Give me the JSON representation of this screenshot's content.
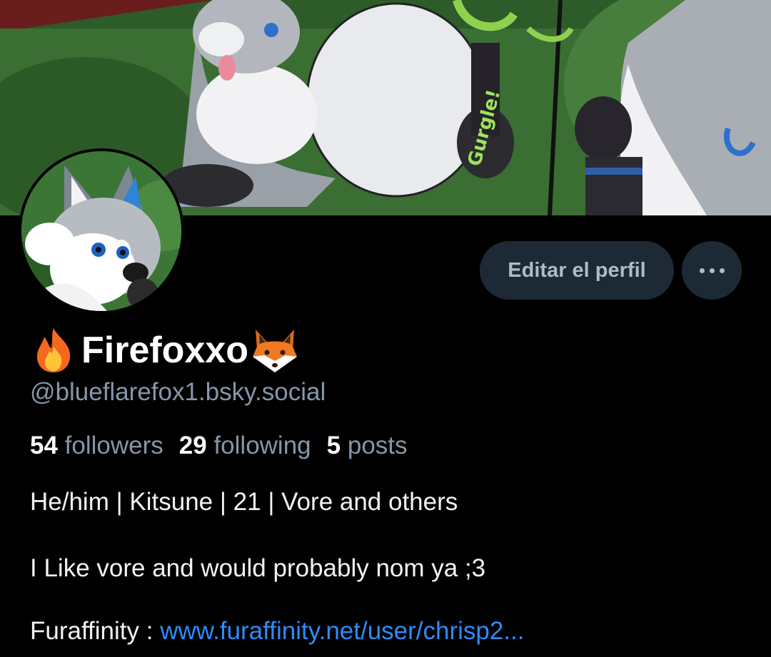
{
  "profile": {
    "display_name": "Firefoxxo",
    "name_prefix_icon": "fire-emoji-icon",
    "name_suffix_icon": "fox-emoji-icon",
    "handle": "@blueflarefox1.bsky.social",
    "stats": {
      "followers_count": "54",
      "followers_label": "followers",
      "following_count": "29",
      "following_label": "following",
      "posts_count": "5",
      "posts_label": "posts"
    },
    "bio": {
      "line1": "He/him | Kitsune | 21 | Vore and others",
      "line2": "I Like vore and would probably nom ya ;3",
      "line3_prefix": "Furaffinity : ",
      "line3_link": "www.furaffinity.net/user/chrisp2..."
    }
  },
  "actions": {
    "edit_profile_label": "Editar el perfil",
    "more_icon": "ellipsis-icon"
  },
  "colors": {
    "background": "#000000",
    "button_bg": "#1e2936",
    "button_text": "#aebbc9",
    "muted_text": "#8796a8",
    "link": "#2d8cff"
  }
}
